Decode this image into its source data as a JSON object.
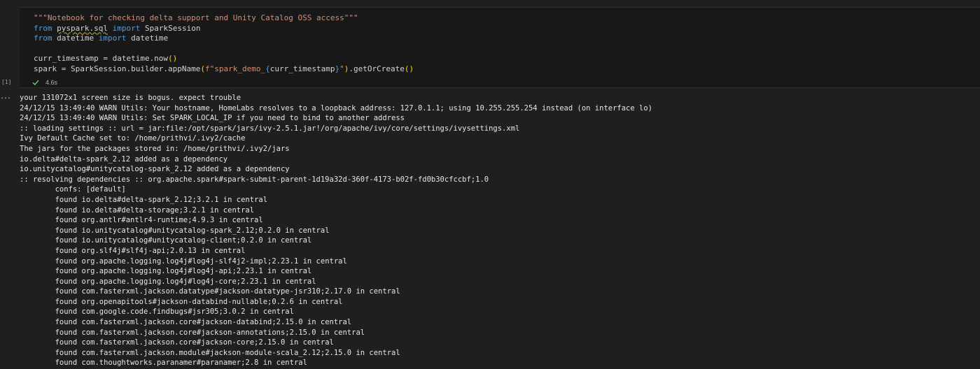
{
  "cell": {
    "execution_count": "[1]",
    "code_lines": [
      [
        {
          "t": "\"\"\"Notebook for checking delta support and Unity Catalog OSS access\"\"\"",
          "c": "str"
        }
      ],
      [
        {
          "t": "from",
          "c": "kw"
        },
        {
          "t": " ",
          "c": "plain"
        },
        {
          "t": "pyspark.sql",
          "c": "plain",
          "squiggle": true
        },
        {
          "t": " ",
          "c": "plain"
        },
        {
          "t": "import",
          "c": "kw"
        },
        {
          "t": " SparkSession",
          "c": "plain"
        }
      ],
      [
        {
          "t": "from",
          "c": "kw"
        },
        {
          "t": " datetime ",
          "c": "plain"
        },
        {
          "t": "import",
          "c": "kw"
        },
        {
          "t": " datetime",
          "c": "plain"
        }
      ],
      [
        {
          "t": "",
          "c": "plain"
        }
      ],
      [
        {
          "t": "curr_timestamp = datetime.now",
          "c": "plain"
        },
        {
          "t": "()",
          "c": "paren"
        }
      ],
      [
        {
          "t": "spark = SparkSession.builder.appName",
          "c": "plain"
        },
        {
          "t": "(",
          "c": "paren"
        },
        {
          "t": "f\"spark_demo_",
          "c": "str"
        },
        {
          "t": "{",
          "c": "brace"
        },
        {
          "t": "curr_timestamp",
          "c": "plain"
        },
        {
          "t": "}",
          "c": "brace"
        },
        {
          "t": "\"",
          "c": "str"
        },
        {
          "t": ")",
          "c": "paren"
        },
        {
          "t": ".getOrCreate",
          "c": "plain"
        },
        {
          "t": "()",
          "c": "paren"
        }
      ]
    ],
    "status": {
      "icon": "check-icon",
      "duration": "4.6s",
      "color": "#89d185"
    }
  },
  "output": {
    "menu_icon": "...",
    "lines": [
      "your 131072x1 screen size is bogus. expect trouble",
      "24/12/15 13:49:40 WARN Utils: Your hostname, HomeLabs resolves to a loopback address: 127.0.1.1; using 10.255.255.254 instead (on interface lo)",
      "24/12/15 13:49:40 WARN Utils: Set SPARK_LOCAL_IP if you need to bind to another address",
      ":: loading settings :: url = jar:file:/opt/spark/jars/ivy-2.5.1.jar!/org/apache/ivy/core/settings/ivysettings.xml",
      "Ivy Default Cache set to: /home/prithvi/.ivy2/cache",
      "The jars for the packages stored in: /home/prithvi/.ivy2/jars",
      "io.delta#delta-spark_2.12 added as a dependency",
      "io.unitycatalog#unitycatalog-spark_2.12 added as a dependency",
      ":: resolving dependencies :: org.apache.spark#spark-submit-parent-1d19a32d-360f-4173-b02f-fd0b30cfccbf;1.0",
      "\tconfs: [default]",
      "\tfound io.delta#delta-spark_2.12;3.2.1 in central",
      "\tfound io.delta#delta-storage;3.2.1 in central",
      "\tfound org.antlr#antlr4-runtime;4.9.3 in central",
      "\tfound io.unitycatalog#unitycatalog-spark_2.12;0.2.0 in central",
      "\tfound io.unitycatalog#unitycatalog-client;0.2.0 in central",
      "\tfound org.slf4j#slf4j-api;2.0.13 in central",
      "\tfound org.apache.logging.log4j#log4j-slf4j2-impl;2.23.1 in central",
      "\tfound org.apache.logging.log4j#log4j-api;2.23.1 in central",
      "\tfound org.apache.logging.log4j#log4j-core;2.23.1 in central",
      "\tfound com.fasterxml.jackson.datatype#jackson-datatype-jsr310;2.17.0 in central",
      "\tfound org.openapitools#jackson-databind-nullable;0.2.6 in central",
      "\tfound com.google.code.findbugs#jsr305;3.0.2 in central",
      "\tfound com.fasterxml.jackson.core#jackson-databind;2.15.0 in central",
      "\tfound com.fasterxml.jackson.core#jackson-annotations;2.15.0 in central",
      "\tfound com.fasterxml.jackson.core#jackson-core;2.15.0 in central",
      "\tfound com.fasterxml.jackson.module#jackson-module-scala_2.12;2.15.0 in central",
      "\tfound com.thoughtworks.paranamer#paranamer;2.8 in central"
    ]
  }
}
